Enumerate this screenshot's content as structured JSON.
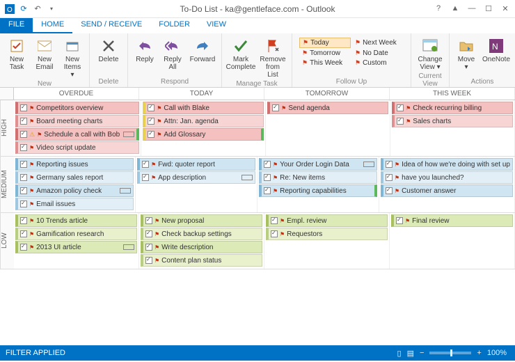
{
  "titlebar": {
    "title": "To-Do List - ka@gentleface.com - Outlook"
  },
  "wincontrols": {
    "help": "?",
    "up": "▲",
    "min": "—",
    "max": "☐",
    "close": "✕"
  },
  "tabs": {
    "file": "FILE",
    "home": "HOME",
    "sendreceive": "SEND / RECEIVE",
    "folder": "FOLDER",
    "view": "VIEW"
  },
  "ribbon": {
    "new": {
      "label": "New",
      "task": "New Task",
      "email": "New Email",
      "items": "New Items ▾"
    },
    "delete": {
      "label": "Delete",
      "btn": "Delete"
    },
    "respond": {
      "label": "Respond",
      "reply": "Reply",
      "replyall": "Reply All",
      "forward": "Forward"
    },
    "manage": {
      "label": "Manage Task",
      "complete": "Mark Complete",
      "remove": "Remove from List"
    },
    "followup": {
      "label": "Follow Up",
      "today": "Today",
      "tomorrow": "Tomorrow",
      "thisweek": "This Week",
      "nextweek": "Next Week",
      "nodate": "No Date",
      "custom": "Custom"
    },
    "currentview": {
      "label": "Current View",
      "change": "Change View ▾"
    },
    "actions": {
      "label": "Actions",
      "move": "Move ▾",
      "onenote": "OneNote"
    }
  },
  "columns": [
    "OVERDUE",
    "TODAY",
    "TOMORROW",
    "THIS WEEK"
  ],
  "priorities": [
    "HIGH",
    "MEDIUM",
    "LOW"
  ],
  "tasks": {
    "high": {
      "overdue": [
        {
          "t": "Competitors overview",
          "c": "c-high"
        },
        {
          "t": "Board meeting charts",
          "c": "c-high2"
        },
        {
          "t": "Schedule a call with Bob",
          "c": "c-high",
          "bat": true,
          "warn": true,
          "acc": true
        },
        {
          "t": "Video script update",
          "c": "c-high2"
        }
      ],
      "today": [
        {
          "t": "Call with Blake",
          "c": "c-high",
          "ylead": true
        },
        {
          "t": "Attn: Jan. agenda",
          "c": "c-high2",
          "ylead": true
        },
        {
          "t": "Add Glossary",
          "c": "c-high",
          "ylead": true,
          "acc": true
        }
      ],
      "tomorrow": [
        {
          "t": "Send agenda",
          "c": "c-high"
        }
      ],
      "thisweek": [
        {
          "t": "Check recurring billing",
          "c": "c-high"
        },
        {
          "t": "Sales charts",
          "c": "c-high2"
        }
      ]
    },
    "medium": {
      "overdue": [
        {
          "t": "Reporting issues",
          "c": "c-med"
        },
        {
          "t": "Germany sales report",
          "c": "c-med2"
        },
        {
          "t": "Amazon policy check",
          "c": "c-med",
          "bat": true
        },
        {
          "t": "Email issues",
          "c": "c-med2"
        }
      ],
      "today": [
        {
          "t": "Fwd: quoter report",
          "c": "c-med"
        },
        {
          "t": "App description",
          "c": "c-med2",
          "bat": true
        }
      ],
      "tomorrow": [
        {
          "t": "Your Order Login Data",
          "c": "c-med",
          "bat": true
        },
        {
          "t": "Re: New items",
          "c": "c-med2"
        },
        {
          "t": "Reporting capabilities",
          "c": "c-med",
          "acc": true
        }
      ],
      "thisweek": [
        {
          "t": "Idea of how we're doing with set up",
          "c": "c-med"
        },
        {
          "t": "have you launched?",
          "c": "c-med2"
        },
        {
          "t": "Customer answer",
          "c": "c-med"
        }
      ]
    },
    "low": {
      "overdue": [
        {
          "t": "10 Trends article",
          "c": "c-low"
        },
        {
          "t": "Gamification research",
          "c": "c-low2"
        },
        {
          "t": "2013 UI article",
          "c": "c-low",
          "bat": true
        }
      ],
      "today": [
        {
          "t": "New proposal",
          "c": "c-low"
        },
        {
          "t": "Check backup settings",
          "c": "c-low2"
        },
        {
          "t": "Write description",
          "c": "c-low"
        },
        {
          "t": "Content plan status",
          "c": "c-low2"
        }
      ],
      "tomorrow": [
        {
          "t": "Empl. review",
          "c": "c-low"
        },
        {
          "t": "Requestors",
          "c": "c-low2"
        }
      ],
      "thisweek": [
        {
          "t": "Final review",
          "c": "c-low"
        }
      ]
    }
  },
  "status": {
    "filter": "FILTER APPLIED",
    "zoom": "100%"
  }
}
